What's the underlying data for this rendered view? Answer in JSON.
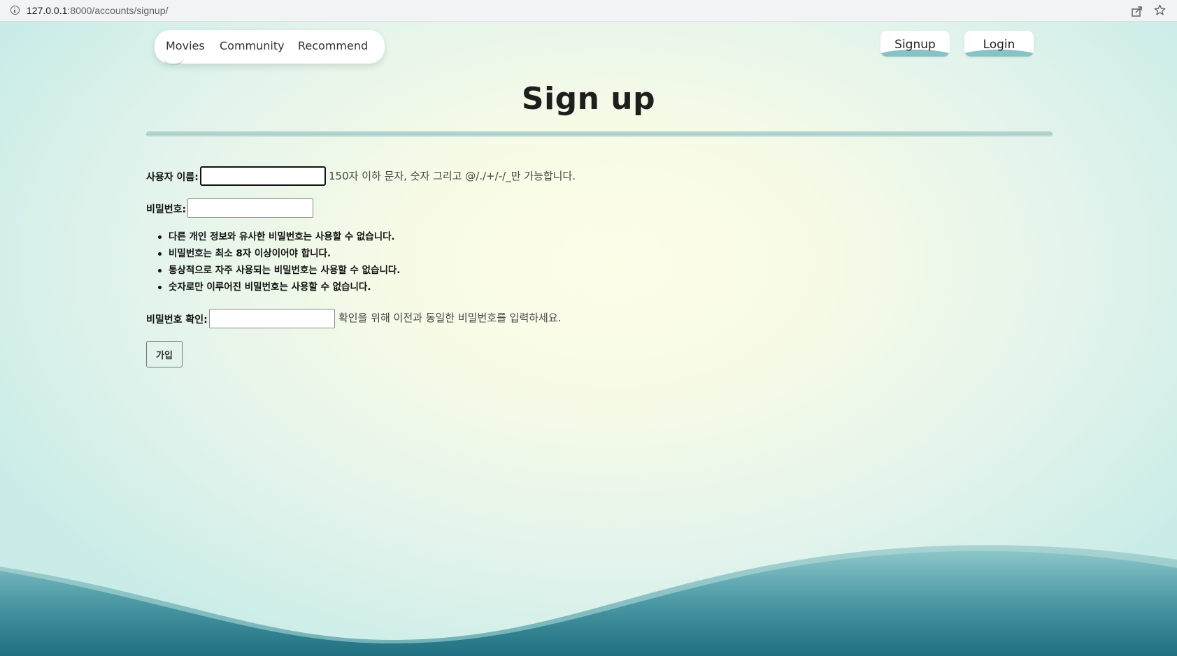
{
  "browser": {
    "url_host": "127.0.0.1",
    "url_rest": ":8000/accounts/signup/"
  },
  "nav": {
    "links": [
      "Movies",
      "Community",
      "Recommend"
    ],
    "signup": "Signup",
    "login": "Login"
  },
  "page": {
    "title": "Sign up"
  },
  "form": {
    "username_label": "사용자 이름:",
    "username_value": "",
    "username_help": "150자 이하 문자, 숫자 그리고 @/./+/-/_만 가능합니다.",
    "password_label": "비밀번호:",
    "password_value": "",
    "password_rules": [
      "다른 개인 정보와 유사한 비밀번호는 사용할 수 없습니다.",
      "비밀번호는 최소 8자 이상이어야 합니다.",
      "통상적으로 자주 사용되는 비밀번호는 사용할 수 없습니다.",
      "숫자로만 이루어진 비밀번호는 사용할 수 없습니다."
    ],
    "password2_label": "비밀번호 확인:",
    "password2_value": "",
    "password2_help": "확인을 위해 이전과 동일한 비밀번호를 입력하세요.",
    "submit_label": "가입"
  },
  "colors": {
    "wave_top": "#8cc6c8",
    "wave_deep": "#1f6f80",
    "accent": "#87c2c5"
  }
}
